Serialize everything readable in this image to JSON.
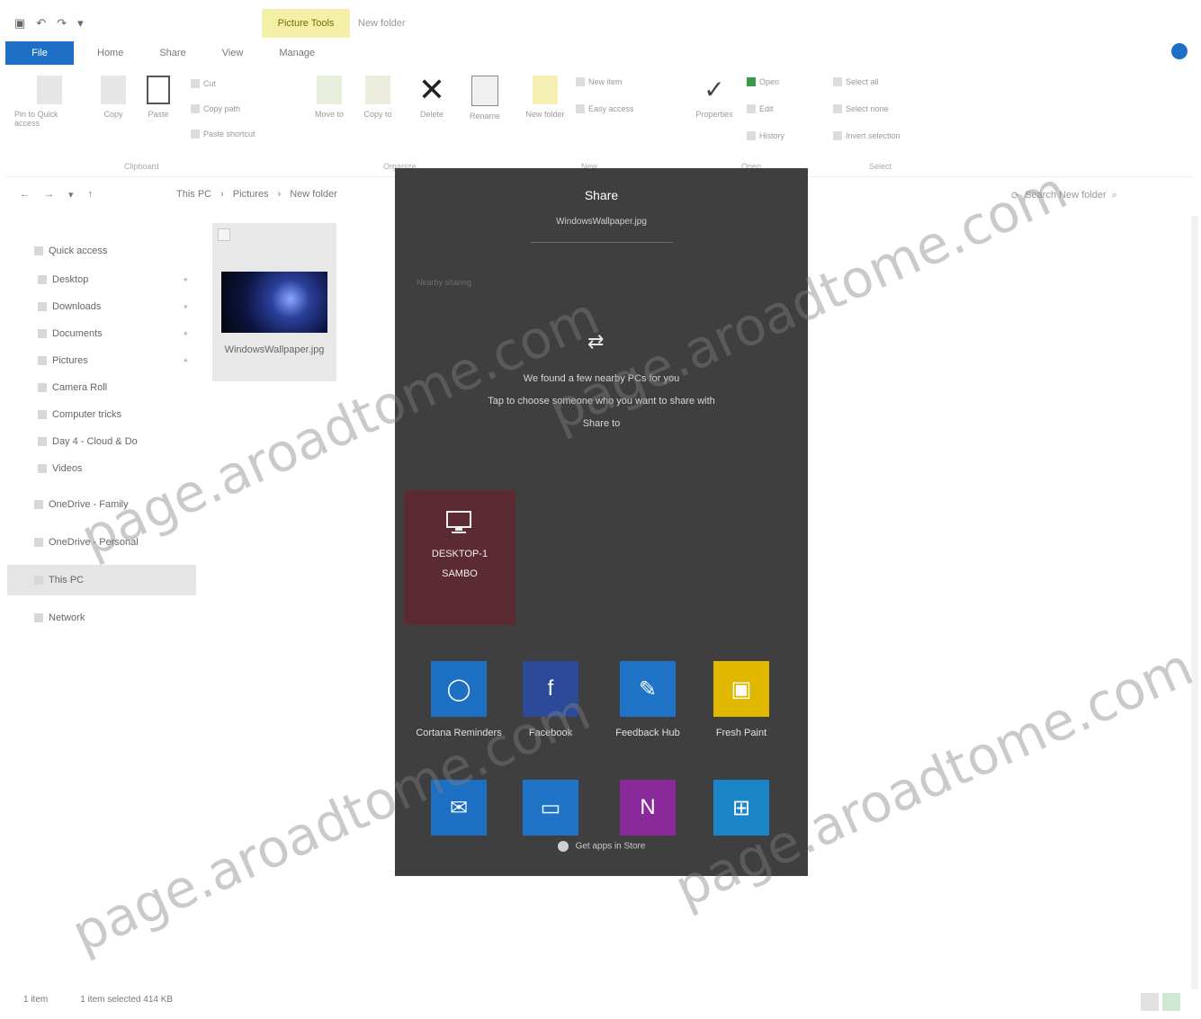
{
  "qat": {
    "icons": [
      "save-icon",
      "undo-icon",
      "redo-icon",
      "dropdown-icon"
    ]
  },
  "context_tab": {
    "label": "Picture Tools",
    "sub": "New folder"
  },
  "tabs": [
    {
      "label": "File"
    },
    {
      "label": "Home"
    },
    {
      "label": "Share"
    },
    {
      "label": "View"
    },
    {
      "label": "Manage"
    }
  ],
  "ribbon": {
    "pin_label": "Pin to Quick access",
    "copy_label": "Copy",
    "paste_label": "Paste",
    "cut_label": "Cut",
    "copy_path_label": "Copy path",
    "paste_shortcut_label": "Paste shortcut",
    "move_to_label": "Move to",
    "copy_to_label": "Copy to",
    "delete_label": "Delete",
    "rename_label": "Rename",
    "new_folder_label": "New folder",
    "new_item_label": "New item",
    "easy_access_label": "Easy access",
    "properties_label": "Properties",
    "open_label": "Open",
    "edit_label": "Edit",
    "history_label": "History",
    "select_all_label": "Select all",
    "select_none_label": "Select none",
    "invert_selection_label": "Invert selection",
    "groups": [
      "Clipboard",
      "Organize",
      "New",
      "Open",
      "Select"
    ]
  },
  "address": {
    "path": [
      "This PC",
      "Pictures",
      "New folder"
    ],
    "search_placeholder": "Search New folder"
  },
  "navpane": {
    "quick_access": "Quick access",
    "items": [
      "Desktop",
      "Downloads",
      "Documents",
      "Pictures",
      "Camera Roll",
      "Computer tricks",
      "Day 4 - Cloud & Do",
      "Videos"
    ],
    "onedrive_family": "OneDrive - Family",
    "onedrive_personal": "OneDrive - Personal",
    "this_pc": "This PC",
    "network": "Network"
  },
  "file": {
    "name": "WindowsWallpaper.jpg"
  },
  "share": {
    "title": "Share",
    "file_name": "WindowsWallpaper.jpg",
    "section_label": "Nearby sharing",
    "message_line1": "We found a few nearby PCs for you",
    "message_line2": "Tap to choose someone who you want to share with",
    "message_line3": "Share to",
    "device": {
      "name_line1": "DESKTOP-1",
      "name_line2": "SAMBO"
    },
    "apps": [
      {
        "label": "Cortana Reminders",
        "icon": "cortana-icon",
        "color": "#1c6fc2"
      },
      {
        "label": "Facebook",
        "icon": "facebook-icon",
        "color": "#2d4a9a"
      },
      {
        "label": "Feedback Hub",
        "icon": "feedback-icon",
        "color": "#1f74c8"
      },
      {
        "label": "Fresh Paint",
        "icon": "fresh-paint-icon",
        "color": "#e0b800"
      },
      {
        "label": "Mail",
        "icon": "mail-icon",
        "color": "#1c6fc2"
      },
      {
        "label": "Messaging",
        "icon": "messaging-icon",
        "color": "#1f74c8"
      },
      {
        "label": "OneNote",
        "icon": "onenote-icon",
        "color": "#8a2a9a"
      },
      {
        "label": "Store",
        "icon": "store-icon",
        "color": "#1a86c8"
      }
    ],
    "store_link": "Get apps in Store"
  },
  "status": {
    "items": "1 item",
    "selected": "1 item selected  414 KB"
  },
  "watermark": "page.aroadtome.com"
}
